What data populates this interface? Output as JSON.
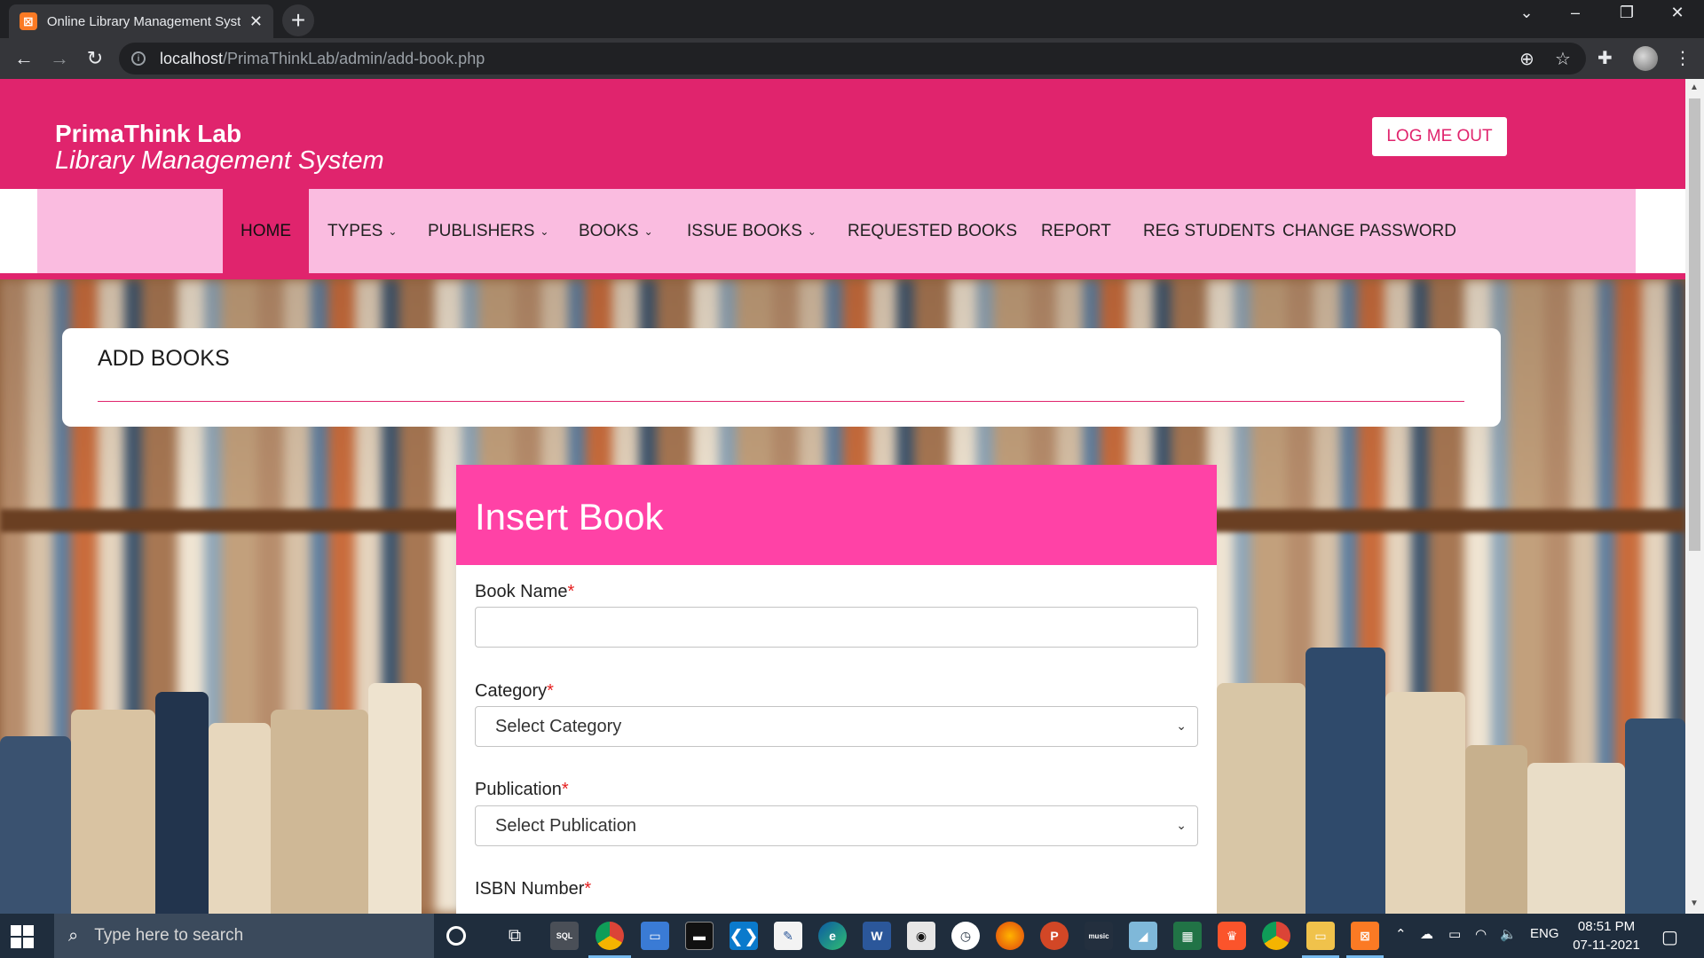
{
  "browser": {
    "tab_title": "Online Library Management System",
    "tab_favicon": "xampp-icon",
    "url_host": "localhost",
    "url_path": "/PrimaThinkLab/admin/add-book.php"
  },
  "header": {
    "brand_name": "PrimaThink Lab",
    "brand_subtitle": "Library Management System",
    "logout_label": "LOG ME OUT"
  },
  "nav": {
    "items": [
      {
        "label": "HOME",
        "dropdown": false
      },
      {
        "label": "TYPES",
        "dropdown": true
      },
      {
        "label": "PUBLISHERS",
        "dropdown": true
      },
      {
        "label": "BOOKS",
        "dropdown": true
      },
      {
        "label": "ISSUE BOOKS",
        "dropdown": true
      },
      {
        "label": "REQUESTED BOOKS",
        "dropdown": false
      },
      {
        "label": "REPORT",
        "dropdown": false
      },
      {
        "label": "REG STUDENTS",
        "dropdown": false
      },
      {
        "label": "CHANGE PASSWORD",
        "dropdown": false
      }
    ]
  },
  "page": {
    "title": "ADD BOOKS"
  },
  "form": {
    "heading": "Insert Book",
    "required_mark": "*",
    "book_name": {
      "label": "Book Name",
      "value": ""
    },
    "category": {
      "label": "Category",
      "selected": "Select Category"
    },
    "publication": {
      "label": "Publication",
      "selected": "Select Publication"
    },
    "isbn": {
      "label": "ISBN Number"
    }
  },
  "taskbar": {
    "search_placeholder": "Type here to search",
    "language": "ENG",
    "time": "08:51 PM",
    "date": "07-11-2021"
  },
  "colors": {
    "brand_pink": "#e0246d",
    "nav_bg": "#fabce0",
    "card_header": "#ff42a6"
  }
}
